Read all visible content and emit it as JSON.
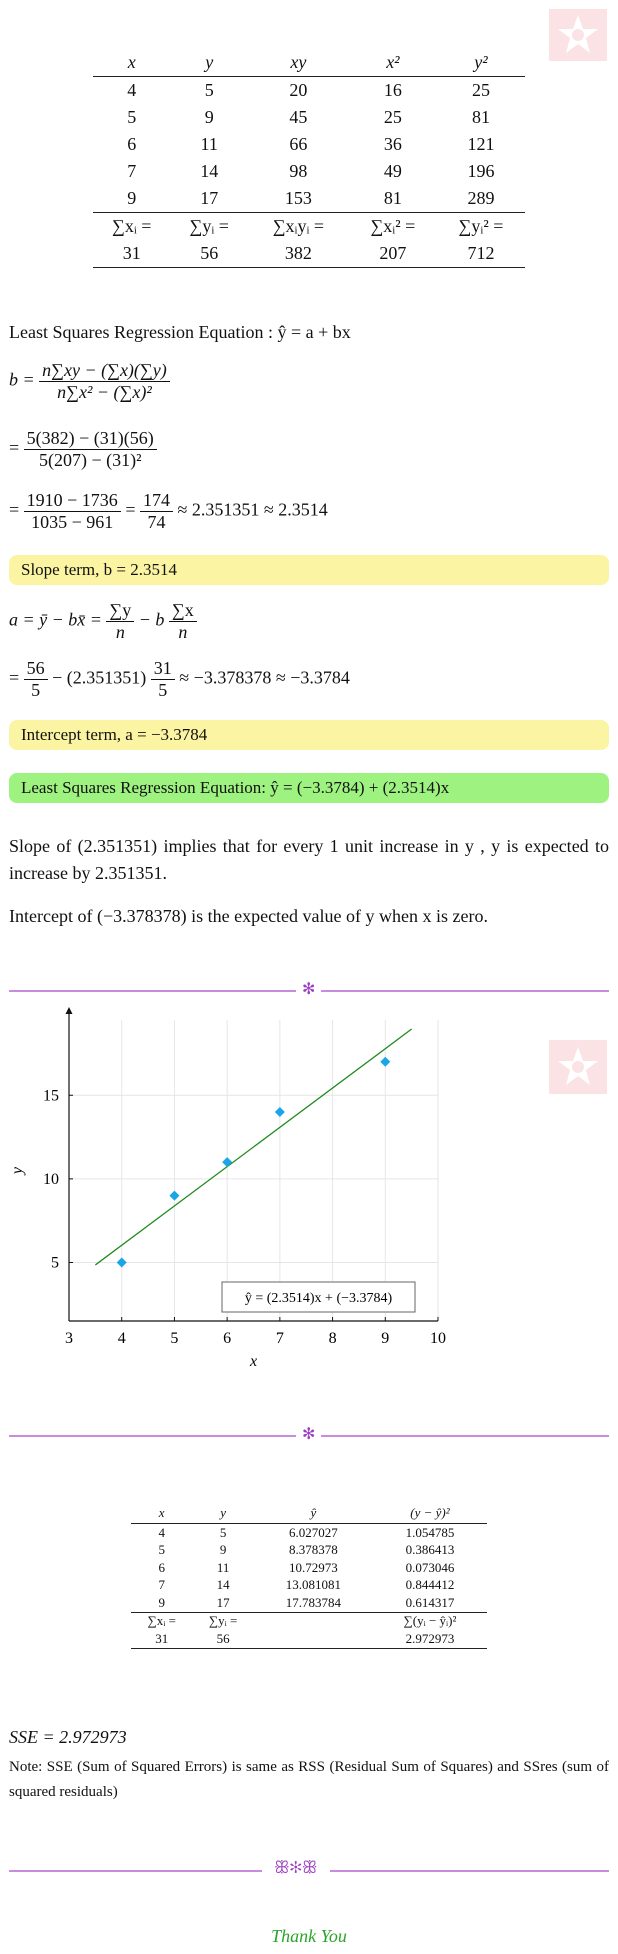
{
  "table1": {
    "headers": [
      "x",
      "y",
      "xy",
      "x²",
      "y²"
    ],
    "rows": [
      [
        "4",
        "5",
        "20",
        "16",
        "25"
      ],
      [
        "5",
        "9",
        "45",
        "25",
        "81"
      ],
      [
        "6",
        "11",
        "66",
        "36",
        "121"
      ],
      [
        "7",
        "14",
        "98",
        "49",
        "196"
      ],
      [
        "9",
        "17",
        "153",
        "81",
        "289"
      ]
    ],
    "sum_labels": [
      "∑xᵢ =",
      "∑yᵢ =",
      "∑xᵢyᵢ =",
      "∑xᵢ² =",
      "∑yᵢ² ="
    ],
    "sums": [
      "31",
      "56",
      "382",
      "207",
      "712"
    ]
  },
  "regression_heading": "Least Squares Regression Equation : ŷ = a + bx",
  "b_formula": {
    "lhs": "b =",
    "num": "n∑xy − (∑x)(∑y)",
    "den": "n∑x² − (∑x)²"
  },
  "b_step2": {
    "eq": "=",
    "num": "5(382) − (31)(56)",
    "den": "5(207) − (31)²"
  },
  "b_step3": {
    "eq": "=",
    "num1": "1910 − 1736",
    "den1": "1035 − 961",
    "eq2": "=",
    "num2": "174",
    "den2": "74",
    "tail": "≈ 2.351351 ≈ 2.3514"
  },
  "slope_box": "Slope term, b = 2.3514",
  "a_formula": {
    "lhs": "a = ȳ − bx̄ =",
    "num1": "∑y",
    "den1": "n",
    "mid": "− b",
    "num2": "∑x",
    "den2": "n"
  },
  "a_step2": {
    "eq": "=",
    "num1": "56",
    "den1": "5",
    "mid": "− (2.351351)",
    "num2": "31",
    "den2": "5",
    "tail": "≈ −3.378378 ≈ −3.3784"
  },
  "intercept_box": "Intercept term, a = −3.3784",
  "equation_box": "Least Squares Regression Equation:  ŷ = (−3.3784) + (2.3514)x",
  "interp1": "Slope of (2.351351) implies that for every 1 unit increase in y , y is expected to increase by 2.351351.",
  "interp2": "Intercept of (−3.378378) is the expected value of y when x is zero.",
  "chart_data": {
    "type": "scatter",
    "x": [
      4,
      5,
      6,
      7,
      9
    ],
    "y": [
      5,
      9,
      11,
      14,
      17
    ],
    "xlabel": "x",
    "ylabel": "y",
    "xlim": [
      3,
      10
    ],
    "ylim": [
      1.5,
      19.5
    ],
    "xticks": [
      "3",
      "4",
      "5",
      "6",
      "7",
      "8",
      "9",
      "10"
    ],
    "yticks": [
      "5",
      "10",
      "15"
    ],
    "grid": true,
    "regression_line": {
      "slope": 2.3514,
      "intercept": -3.3784,
      "x_range": [
        3.5,
        9.5
      ]
    },
    "legend_label": "ŷ = (2.3514)x + (−3.3784)",
    "legend_position": "bottom-right",
    "colors": {
      "points": "#1aa5e6",
      "line": "#1f8a1f"
    }
  },
  "table2": {
    "headers": [
      "x",
      "y",
      "ŷ",
      "(y − ŷ)²"
    ],
    "rows": [
      [
        "4",
        "5",
        "6.027027",
        "1.054785"
      ],
      [
        "5",
        "9",
        "8.378378",
        "0.386413"
      ],
      [
        "6",
        "11",
        "10.72973",
        "0.073046"
      ],
      [
        "7",
        "14",
        "13.081081",
        "0.844412"
      ],
      [
        "9",
        "17",
        "17.783784",
        "0.614317"
      ]
    ],
    "sum_labels": [
      "∑xᵢ =",
      "∑yᵢ =",
      "",
      "∑(yᵢ − ŷᵢ)²"
    ],
    "sums": [
      "31",
      "56",
      "",
      "2.972973"
    ]
  },
  "sse_line": "SSE = 2.972973",
  "note": "Note: SSE (Sum of Squared Errors) is same as RSS (Residual Sum of Squares) and SSres (sum of squared residuals)",
  "ornament1": "✻",
  "ornament2": "✻",
  "ornament3": "ꕥ✻ꕥ",
  "thank_you": "Thank You",
  "colors": {
    "slope_box": "#fbf4a2",
    "equation_box": "#9df280",
    "separator": "#c78be0",
    "thank_you": "#2aa52a",
    "watermark": "#f6d3d6"
  }
}
